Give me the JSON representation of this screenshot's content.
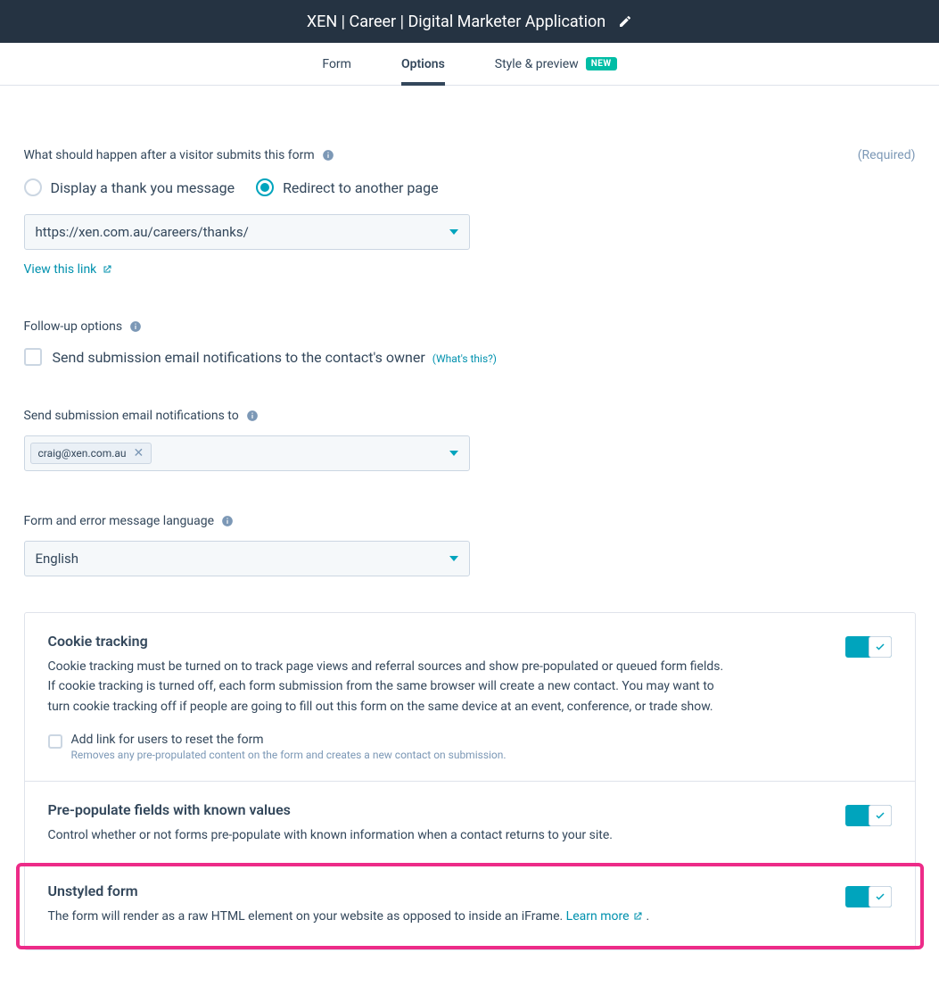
{
  "header": {
    "title": "XEN | Career | Digital Marketer Application"
  },
  "tabs": {
    "form": "Form",
    "options": "Options",
    "style_preview": "Style & preview",
    "new_badge": "NEW"
  },
  "submit_action": {
    "label": "What should happen after a visitor submits this form",
    "required": "(Required)",
    "radio_thankyou": "Display a thank you message",
    "radio_redirect": "Redirect to another page",
    "redirect_url": "https://xen.com.au/careers/thanks/",
    "view_link": "View this link"
  },
  "followup": {
    "label": "Follow-up options",
    "checkbox_label": "Send submission email notifications to the contact's owner",
    "whats_this": "(What's this?)"
  },
  "notify": {
    "label": "Send submission email notifications to",
    "tag_value": "craig@xen.com.au"
  },
  "language": {
    "label": "Form and error message language",
    "value": "English"
  },
  "cookie": {
    "title": "Cookie tracking",
    "desc": "Cookie tracking must be turned on to track page views and referral sources and show pre-populated or queued form fields. If cookie tracking is turned off, each form submission from the same browser will create a new contact. You may want to turn cookie tracking off if people are going to fill out this form on the same device at an event, conference, or trade show.",
    "sub_label": "Add link for users to reset the form",
    "sub_help": "Removes any pre-propulated content on the form and creates a new contact on submission."
  },
  "prepopulate": {
    "title": "Pre-populate fields with known values",
    "desc": "Control whether or not forms pre-populate with known information when a contact returns to your site."
  },
  "unstyled": {
    "title": "Unstyled form",
    "desc_pre": "The form will render as a raw HTML element on your website as opposed to inside an iFrame. ",
    "learn_more": "Learn more",
    "desc_post": " ."
  }
}
